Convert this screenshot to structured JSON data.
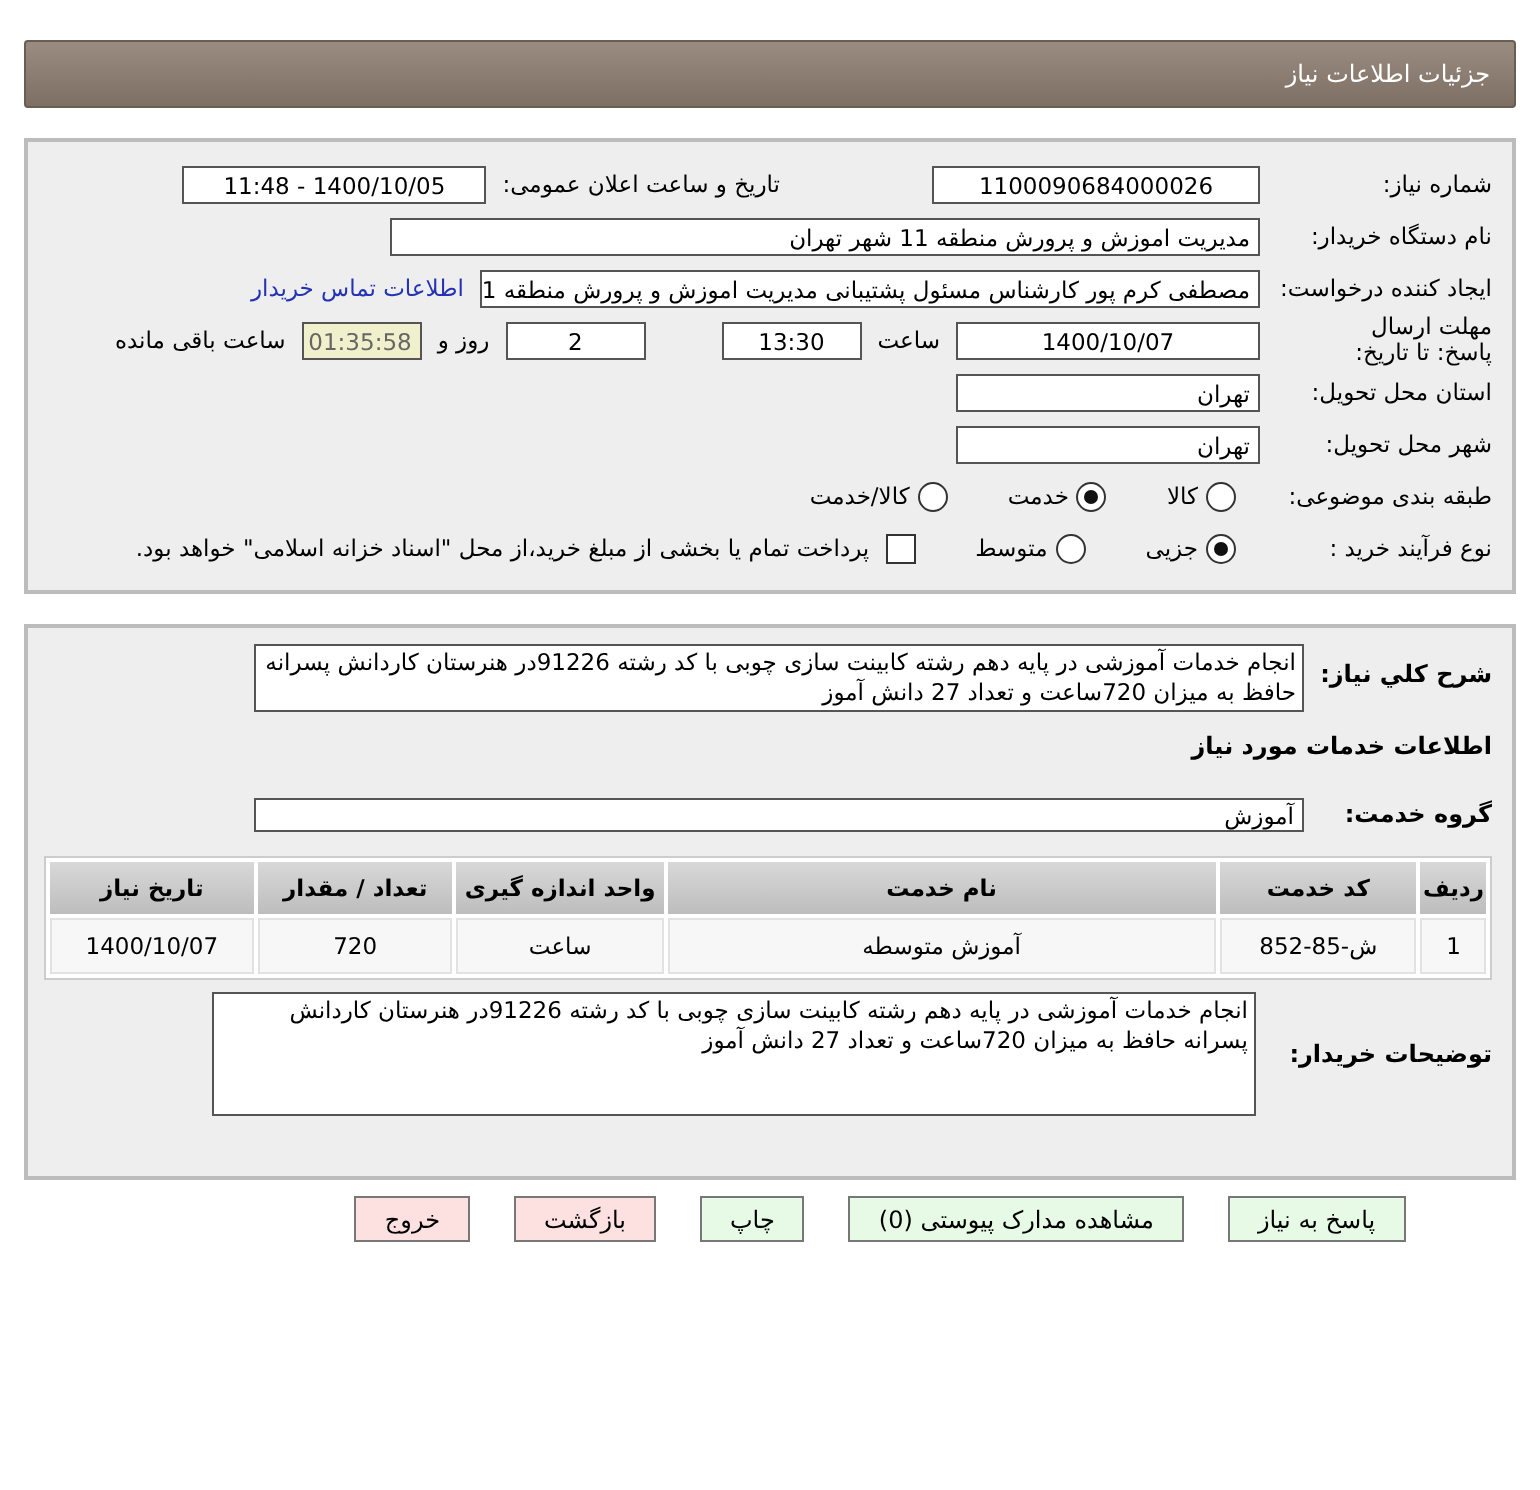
{
  "header": {
    "title": "جزئیات اطلاعات نیاز"
  },
  "need_info": {
    "need_number": {
      "label": "شماره نیاز:",
      "value": "1100090684000026"
    },
    "announce": {
      "label": "تاریخ و ساعت اعلان عمومی:",
      "value": "1400/10/05 - 11:48"
    },
    "buyer_org": {
      "label": "نام دستگاه خریدار:",
      "value": "مدیریت اموزش و پرورش منطقه 11 شهر تهران"
    },
    "requester": {
      "label": "ایجاد کننده درخواست:",
      "value": "مصطفی  کرم پور  کارشناس مسئول پشتیبانی مدیریت اموزش و پرورش منطقه 1",
      "link": "اطلاعات تماس خریدار"
    },
    "deadline": {
      "label": "مهلت ارسال پاسخ: تا تاریخ:",
      "date": "1400/10/07",
      "time_label": "ساعت",
      "time": "13:30",
      "days": "2",
      "days_label": "روز و",
      "remaining": "01:35:58",
      "remaining_label": "ساعت باقی مانده"
    },
    "province": {
      "label": "استان محل تحویل:",
      "value": "تهران"
    },
    "city": {
      "label": "شهر محل تحویل:",
      "value": "تهران"
    },
    "category": {
      "label": "طبقه بندی موضوعی:",
      "options": [
        {
          "label": "کالا",
          "selected": false
        },
        {
          "label": "خدمت",
          "selected": true
        },
        {
          "label": "کالا/خدمت",
          "selected": false
        }
      ]
    },
    "process": {
      "label": "نوع فرآیند خرید :",
      "options": [
        {
          "label": "جزیی",
          "selected": true
        },
        {
          "label": "متوسط",
          "selected": false
        }
      ],
      "payment": {
        "checked": false,
        "label": "پرداخت تمام یا بخشی از مبلغ خرید،از محل \"اسناد خزانه اسلامی\" خواهد بود."
      }
    }
  },
  "details": {
    "description": {
      "label": "شرح کلي نياز:",
      "value": "انجام خدمات آموزشی در پایه دهم رشته کابینت سازی چوبی  با کد رشته 91226در هنرستان کاردانش پسرانه حافظ به میزان 720ساعت و تعداد 27 دانش آموز"
    },
    "services_title": "اطلاعات خدمات مورد نیاز",
    "service_group": {
      "label": "گروه خدمت:",
      "value": "آموزش"
    },
    "table": {
      "columns": [
        "ردیف",
        "کد خدمت",
        "نام خدمت",
        "واحد اندازه گیری",
        "تعداد / مقدار",
        "تاریخ نیاز"
      ],
      "rows": [
        [
          "1",
          "ش-85-852",
          "آموزش متوسطه",
          "ساعت",
          "720",
          "1400/10/07"
        ]
      ]
    },
    "buyer_notes": {
      "label": "توضیحات خریدار:",
      "value": "انجام خدمات آموزشی در پایه دهم رشته کابینت سازی چوبی  با کد رشته 91226در هنرستان کاردانش پسرانه حافظ به میزان 720ساعت و تعداد 27 دانش آموز"
    }
  },
  "buttons": [
    {
      "label": "پاسخ به نیاز",
      "kind": "normal"
    },
    {
      "label": "مشاهده مدارک پیوستی (0)",
      "kind": "normal"
    },
    {
      "label": "چاپ",
      "kind": "normal"
    },
    {
      "label": "بازگشت",
      "kind": "danger"
    },
    {
      "label": "خروج",
      "kind": "danger"
    }
  ]
}
